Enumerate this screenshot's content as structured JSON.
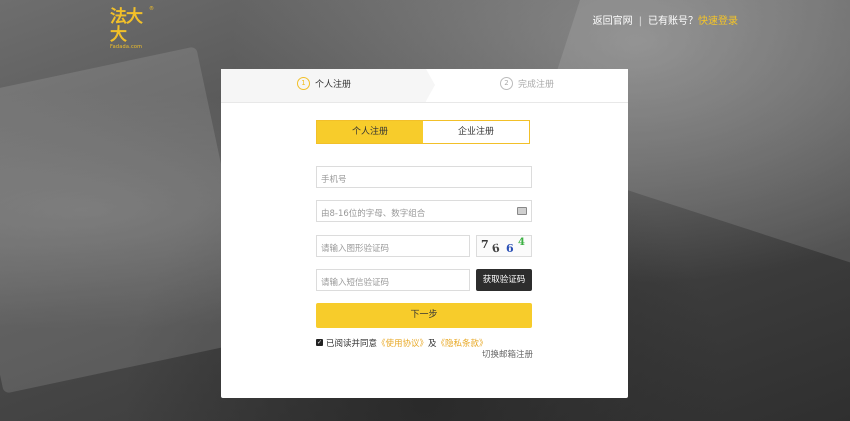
{
  "logo": {
    "main": "法大大",
    "sub": "Fadada.com",
    "reg": "®"
  },
  "topnav": {
    "back_home": "返回官网",
    "separator": "|",
    "have_account": "已有账号？",
    "quick_login": "快速登录"
  },
  "steps": [
    {
      "num": "1",
      "label": "个人注册"
    },
    {
      "num": "2",
      "label": "完成注册"
    }
  ],
  "type_tabs": {
    "personal": "个人注册",
    "enterprise": "企业注册"
  },
  "form": {
    "phone_placeholder": "手机号",
    "password_placeholder": "由8-16位的字母、数字组合",
    "captcha_placeholder": "请输入图形验证码",
    "sms_placeholder": "请输入短信验证码",
    "sms_button": "获取验证码",
    "captcha_chars": [
      "7",
      "6",
      "6",
      "4"
    ]
  },
  "next_button": "下一步",
  "agreement": {
    "prefix": "已阅读并同意",
    "terms": "《使用协议》",
    "and": "及",
    "privacy": "《隐私条款》"
  },
  "switch_email": "切换邮箱注册",
  "colors": {
    "accent": "#f7cc2b",
    "link": "#e8a825",
    "dark_button": "#2d2d2d"
  }
}
